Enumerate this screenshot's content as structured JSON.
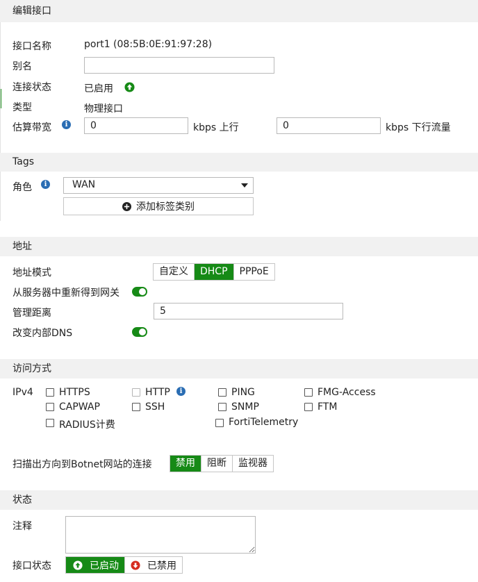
{
  "sections": {
    "edit": "编辑接口",
    "tags": "Tags",
    "address": "地址",
    "access": "访问方式",
    "status": "状态"
  },
  "interface": {
    "name_label": "接口名称",
    "name_value": "port1 (08:5B:0E:91:97:28)",
    "alias_label": "别名",
    "alias_value": "",
    "link_label": "连接状态",
    "link_value": "已启用",
    "type_label": "类型",
    "type_value": "物理接口",
    "bandwidth_label": "估算带宽",
    "upstream_value": "0",
    "upstream_unit": "kbps 上行",
    "downstream_value": "0",
    "downstream_unit": "kbps 下行流量"
  },
  "tags": {
    "role_label": "角色",
    "role_value": "WAN",
    "add_tag_label": "添加标签类别"
  },
  "address": {
    "mode_label": "地址模式",
    "mode_options": [
      "自定义",
      "DHCP",
      "PPPoE"
    ],
    "mode_selected": "DHCP",
    "gateway_label": "从服务器中重新得到网关",
    "distance_label": "管理距离",
    "distance_value": "5",
    "dns_label": "改变内部DNS"
  },
  "access": {
    "ipv4_label": "IPv4",
    "items": [
      "HTTPS",
      "HTTP",
      "PING",
      "FMG-Access",
      "CAPWAP",
      "SSH",
      "SNMP",
      "FTM",
      "RADIUS计费",
      "FortiTelemetry"
    ],
    "botnet_label": "扫描出方向到Botnet网站的连接",
    "botnet_options": [
      "禁用",
      "阻断",
      "监视器"
    ],
    "botnet_selected": "禁用"
  },
  "status": {
    "comment_label": "注释",
    "comment_value": "",
    "iface_status_label": "接口状态",
    "enabled_label": "已启动",
    "disabled_label": "已禁用"
  },
  "colors": {
    "accent_green": "#168a16",
    "info_blue": "#2a6db3",
    "disabled_red": "#d62c1f",
    "section_bg": "#f1f1f1"
  },
  "icons": {
    "link_status": "arrow-up-circle-icon",
    "info": "info-icon",
    "add": "plus-circle-icon",
    "dropdown": "caret-down-icon",
    "enable": "arrow-up-circle-icon",
    "disable": "arrow-down-circle-icon"
  }
}
